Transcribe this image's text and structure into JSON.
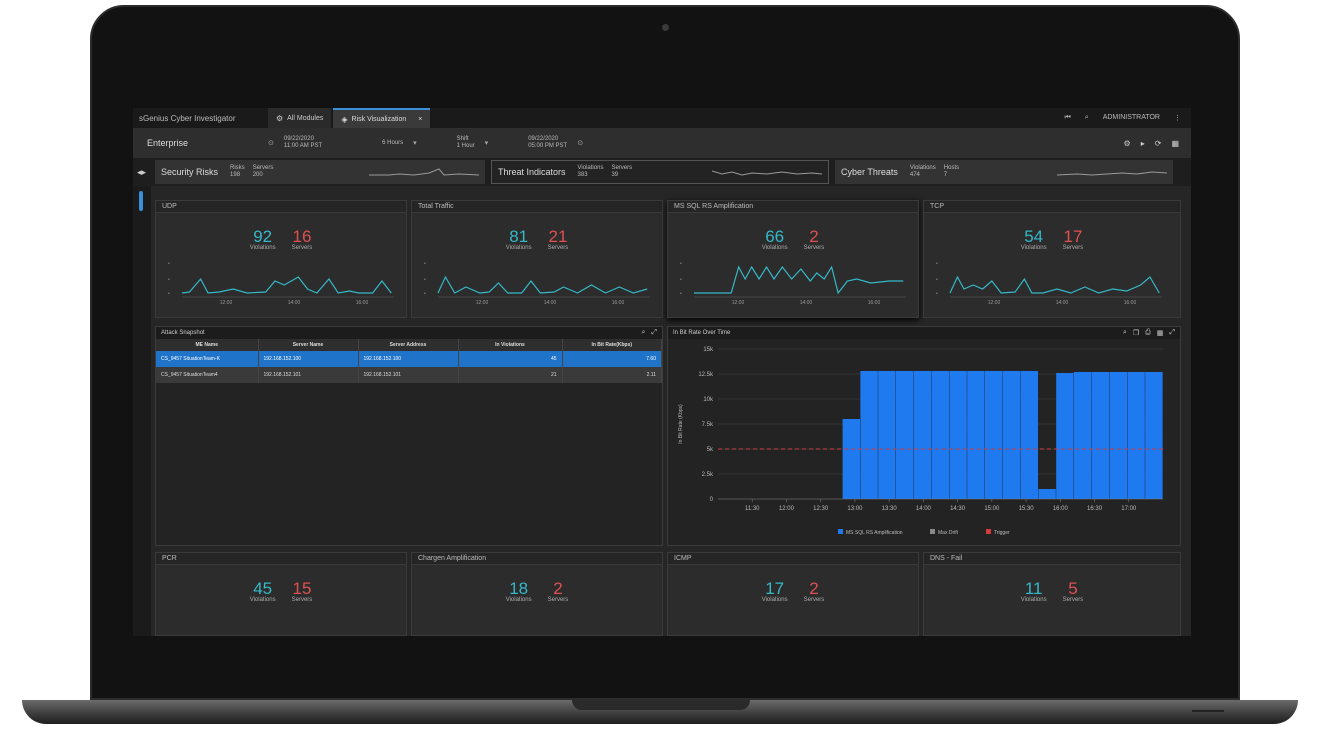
{
  "app": {
    "brand": "sGenius Cyber Investigator"
  },
  "tabs": [
    {
      "label": "All Modules",
      "icon": "modules-icon"
    },
    {
      "label": "Risk Visualization",
      "icon": "risk-icon",
      "close": "×"
    }
  ],
  "topbar_right": {
    "user": "ADMINISTRATOR"
  },
  "subbar": {
    "title": "Enterprise",
    "timeline": [
      {
        "date": "09/22/2020",
        "time": "11:00 AM PST"
      },
      {
        "label": "6 Hours"
      },
      {
        "label": "1 Hour",
        "sub": "Shift"
      },
      {
        "date": "09/22/2020",
        "time": "05:00 PM PST"
      }
    ]
  },
  "kpis": [
    {
      "title": "Security Risks",
      "a_label": "Risks",
      "a_value": "198",
      "b_label": "Servers",
      "b_value": "200"
    },
    {
      "title": "Threat Indicators",
      "a_label": "Violations",
      "a_value": "383",
      "b_label": "Servers",
      "b_value": "39"
    },
    {
      "title": "Cyber Threats",
      "a_label": "Violations",
      "a_value": "474",
      "b_label": "Hosts",
      "b_value": "7"
    }
  ],
  "cards": [
    {
      "title": "UDP",
      "violations": "92",
      "servers": "16"
    },
    {
      "title": "Total Traffic",
      "violations": "81",
      "servers": "21"
    },
    {
      "title": "MS SQL RS Amplification",
      "violations": "66",
      "servers": "2"
    },
    {
      "title": "TCP",
      "violations": "54",
      "servers": "17"
    },
    {
      "title": "PCR",
      "violations": "45",
      "servers": "15"
    },
    {
      "title": "Chargen Amplification",
      "violations": "18",
      "servers": "2"
    },
    {
      "title": "ICMP",
      "violations": "17",
      "servers": "2"
    },
    {
      "title": "DNS - Fail",
      "violations": "11",
      "servers": "5"
    }
  ],
  "labels": {
    "violations": "Violations",
    "servers": "Servers"
  },
  "mini_ticks": [
    "12:00",
    "14:00",
    "16:00"
  ],
  "attack_snapshot": {
    "title": "Attack Snapshot",
    "columns": [
      "ME Name",
      "Server Name",
      "Server Address",
      "In Violations",
      "In Bit Rate(Kbps)"
    ],
    "rows": [
      [
        "CS_9457 SituationTeam-K",
        "192.168.152.100",
        "192.168.152.100",
        "45",
        "7.60"
      ],
      [
        "CS_9457 SituationTeam4",
        "192.168.152.101",
        "192.168.152.101",
        "21",
        "2.11"
      ]
    ]
  },
  "chart_data": {
    "type": "bar",
    "title": "In Bit Rate Over Time",
    "ylabel": "In Bit Rate (Kbps)",
    "y_ticks": [
      "0",
      "2.5k",
      "5k",
      "7.5k",
      "10k",
      "12.5k",
      "15k"
    ],
    "ylim": [
      0,
      15000
    ],
    "x_ticks": [
      "11:30",
      "12:00",
      "12:30",
      "13:00",
      "13:30",
      "14:00",
      "14:30",
      "15:00",
      "15:30",
      "16:00",
      "16:30",
      "17:00"
    ],
    "x": [
      "11:00",
      "11:15",
      "11:30",
      "11:45",
      "12:00",
      "12:15",
      "12:30",
      "12:45",
      "13:00",
      "13:15",
      "13:30",
      "13:45",
      "14:00",
      "14:15",
      "14:30",
      "14:45",
      "15:00",
      "15:15",
      "15:30",
      "15:45",
      "16:00",
      "16:15",
      "16:30",
      "16:45",
      "17:00"
    ],
    "series": [
      {
        "name": "MS SQL RS Amplification",
        "values": [
          0,
          0,
          0,
          0,
          0,
          0,
          0,
          8000,
          12800,
          12800,
          12800,
          12800,
          12800,
          12800,
          12800,
          12800,
          12800,
          12800,
          1000,
          12600,
          12700,
          12700,
          12700,
          12700,
          12700
        ],
        "color": "#1f7af0"
      },
      {
        "name": "Trigger",
        "values": [
          5000
        ],
        "color": "#d23c3c"
      }
    ],
    "legend": [
      "MS SQL RS Amplification",
      "Max Drift",
      "Trigger"
    ]
  }
}
